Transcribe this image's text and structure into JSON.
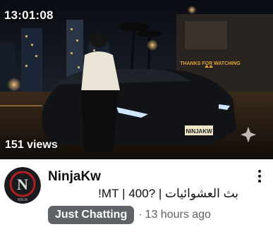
{
  "thumbnail": {
    "duration": "13:01:08",
    "views": "151 views",
    "sign_text": "THANKS FOR WATCHING",
    "plate_text": "NINJAKW",
    "colors": {
      "sky": "#0b0e14",
      "sign": "#e0a23a",
      "headlight": "#cfe4ff"
    }
  },
  "avatar": {
    "letter": "N",
    "sub": "NINJA",
    "ring": "#b22020"
  },
  "channel": {
    "name": "NinjaKw"
  },
  "video": {
    "title": "بث العشوائيات | ?400 | MT!",
    "category": "Just Chatting",
    "separator": "·",
    "age": "13 hours ago"
  },
  "menu": {
    "icon": "more-vert-icon"
  }
}
